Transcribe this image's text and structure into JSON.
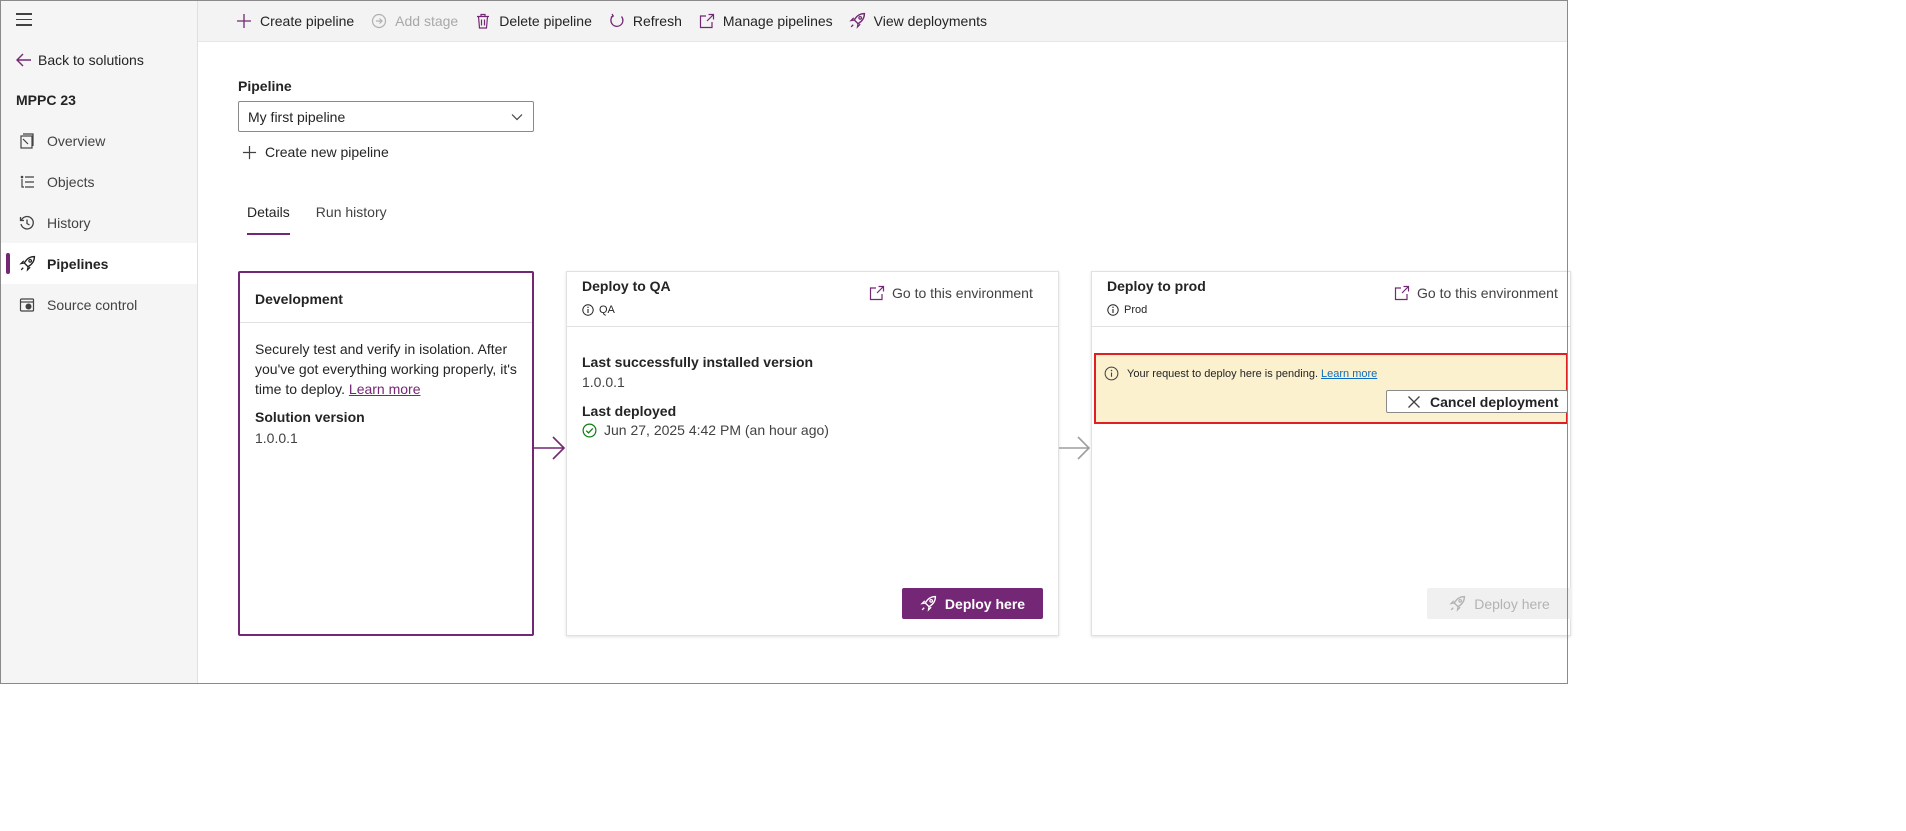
{
  "sidebar": {
    "back_label": "Back to solutions",
    "solution_name": "MPPC 23",
    "items": [
      {
        "label": "Overview",
        "icon": "overview-icon"
      },
      {
        "label": "Objects",
        "icon": "objects-icon"
      },
      {
        "label": "History",
        "icon": "history-icon"
      },
      {
        "label": "Pipelines",
        "icon": "rocket-icon",
        "active": true
      },
      {
        "label": "Source control",
        "icon": "source-control-icon"
      }
    ]
  },
  "toolbar": {
    "create_pipeline": "Create pipeline",
    "add_stage": "Add stage",
    "delete_pipeline": "Delete pipeline",
    "refresh": "Refresh",
    "manage_pipelines": "Manage pipelines",
    "view_deployments": "View deployments"
  },
  "pipeline": {
    "label": "Pipeline",
    "selected": "My first pipeline",
    "create_new": "Create new pipeline"
  },
  "tabs": [
    {
      "label": "Details",
      "active": true
    },
    {
      "label": "Run history",
      "active": false
    }
  ],
  "stages": {
    "development": {
      "title": "Development",
      "description": "Securely test and verify in isolation. After you've got everything working properly, it's time to deploy.",
      "learn_more": "Learn more",
      "solution_version_label": "Solution version",
      "solution_version": "1.0.0.1"
    },
    "qa": {
      "title": "Deploy to QA",
      "environment": "QA",
      "goto_label": "Go to this environment",
      "last_installed_label": "Last successfully installed version",
      "last_installed_value": "1.0.0.1",
      "last_deployed_label": "Last deployed",
      "last_deployed_value": "Jun 27, 2025 4:42 PM (an hour ago)",
      "deploy_label": "Deploy here"
    },
    "prod": {
      "title": "Deploy to prod",
      "environment": "Prod",
      "goto_label": "Go to this environment",
      "pending_message": "Your request to deploy here is pending.",
      "learn_more": "Learn more",
      "cancel_label": "Cancel deployment",
      "deploy_label": "Deploy here"
    }
  },
  "colors": {
    "accent": "#742774",
    "pending_bg": "#fbf1cf",
    "highlight_border": "#e02020",
    "success": "#107c10"
  }
}
